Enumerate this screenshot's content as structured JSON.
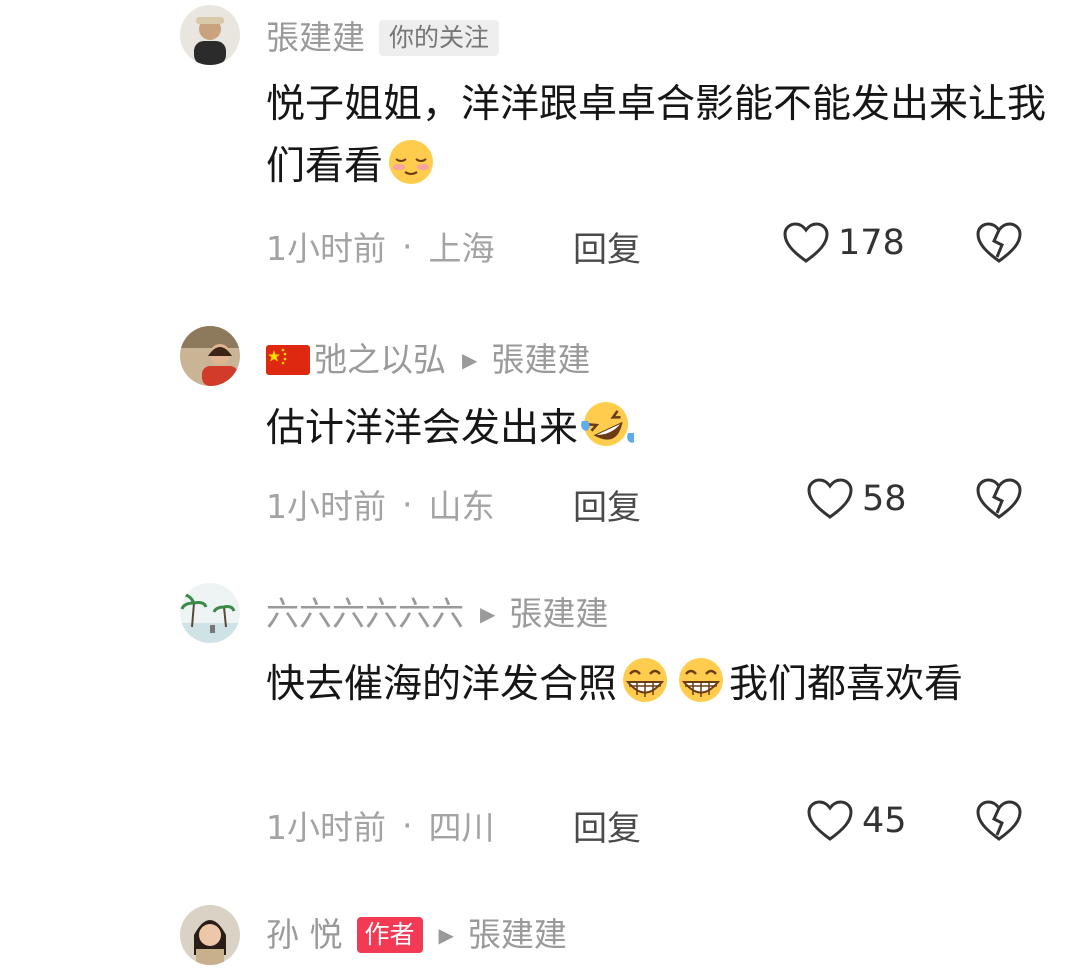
{
  "comments": [
    {
      "author": "張建建",
      "badge": "你的关注",
      "text": "悦子姐姐，洋洋跟卓卓合影能不能发出来让我们看看",
      "emoji": "shy-smile-emoji",
      "time": "1小时前",
      "separator": "·",
      "location": "上海",
      "reply_label": "回复",
      "likes": "178"
    },
    {
      "flag": "china-flag",
      "author": "弛之以弘",
      "reply_to": "張建建",
      "text": "估计洋洋会发出来",
      "emoji": "rofl-emoji",
      "time": "1小时前",
      "separator": "·",
      "location": "山东",
      "reply_label": "回复",
      "likes": "58"
    },
    {
      "author": "六六六六六六",
      "reply_to": "張建建",
      "text_a": "快去催海的洋发合照",
      "text_b": "我们都喜欢看",
      "emoji": "grin-emoji",
      "time": "1小时前",
      "separator": "·",
      "location": "四川",
      "reply_label": "回复",
      "likes": "45"
    },
    {
      "author": "孙 悦",
      "badge": "作者",
      "reply_to": "張建建"
    }
  ],
  "colors": {
    "author_badge": "#f23a55",
    "meta_gray": "#a3a3a3"
  }
}
